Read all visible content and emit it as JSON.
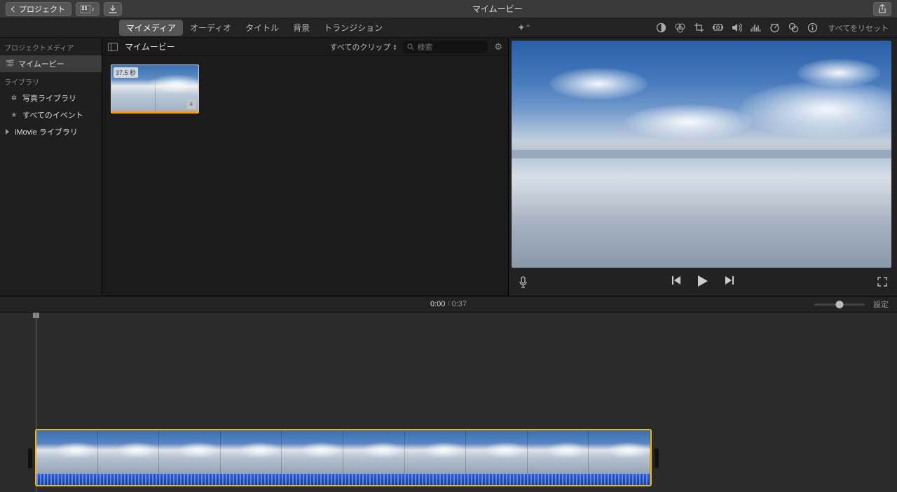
{
  "titlebar": {
    "back_label": "プロジェクト",
    "title": "マイムービー"
  },
  "tabs": {
    "my_media": "マイメディア",
    "audio": "オーディオ",
    "title": "タイトル",
    "background": "背景",
    "transition": "トランジション"
  },
  "adjust": {
    "reset": "すべてをリセット"
  },
  "sidebar": {
    "project_media_h": "プロジェクトメディア",
    "my_movie": "マイムービー",
    "library_h": "ライブラリ",
    "photo_library": "写真ライブラリ",
    "all_events": "すべてのイベント",
    "imovie_library": "iMovie ライブラリ"
  },
  "browser": {
    "title": "マイムービー",
    "filter_label": "すべてのクリップ",
    "search_placeholder": "検索",
    "clip_duration": "37.5 秒"
  },
  "timeline": {
    "current": "0:00",
    "total": "0:37",
    "settings": "設定"
  }
}
